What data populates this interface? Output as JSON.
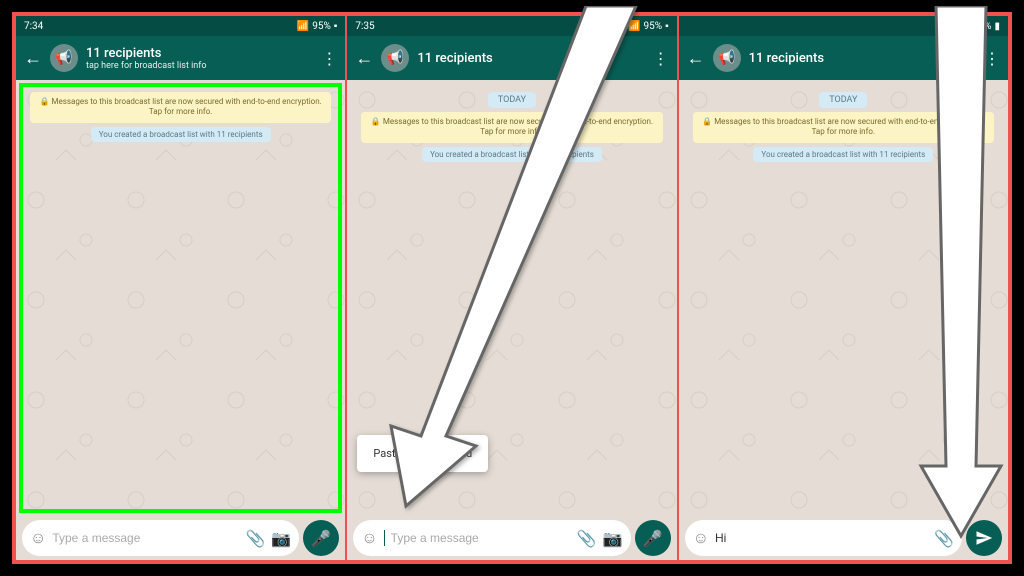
{
  "status": {
    "time1": "7:34",
    "time2": "7:35",
    "time3": "",
    "battery12": "95%",
    "battery3": "100%"
  },
  "header": {
    "title": "11 recipients",
    "subtitle": "tap here for broadcast list info"
  },
  "chat": {
    "today": "TODAY",
    "encrypt": "Messages to this broadcast list are now secured with end-to-end encryption. Tap for more info.",
    "created": "You created a broadcast list with 11 recipients"
  },
  "input": {
    "placeholder": "Type a message",
    "typed": "Hi"
  },
  "context": {
    "paste": "Paste",
    "clipboard": "Clipboard"
  }
}
